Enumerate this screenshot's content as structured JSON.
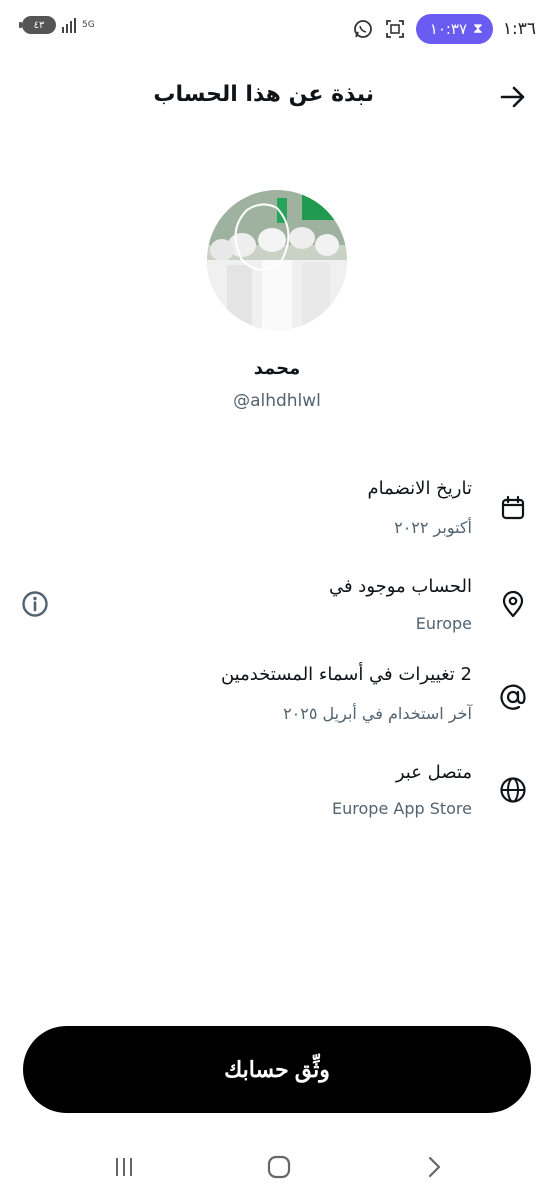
{
  "status_bar": {
    "time": "١:٣٦",
    "timer": "١٠:٣٧",
    "battery": "٤٣",
    "network": "5G"
  },
  "header": {
    "title": "نبذة عن هذا الحساب",
    "back_icon": "arrow-right-icon"
  },
  "profile": {
    "display_name": "محمد",
    "handle": "@alhdhlwl"
  },
  "info": [
    {
      "icon": "calendar-icon",
      "title": "تاريخ الانضمام",
      "subtitle": "أكتوبر ٢٠٢٢"
    },
    {
      "icon": "location-pin-icon",
      "title": "الحساب موجود في",
      "subtitle": "Europe"
    },
    {
      "icon": "at-sign-icon",
      "title": "2 تغييرات في أسماء المستخدمين",
      "subtitle": "آخر استخدام في أبريل ٢٠٢٥"
    },
    {
      "icon": "globe-icon",
      "title": "متصل عبر",
      "subtitle": "Europe App Store"
    }
  ],
  "verify_button": {
    "label": "وثِّق حسابك"
  },
  "colors": {
    "primary_text": "#0f1419",
    "secondary_text": "#536471",
    "button_bg": "#000000",
    "timer_pill": "#6a5cf0"
  }
}
